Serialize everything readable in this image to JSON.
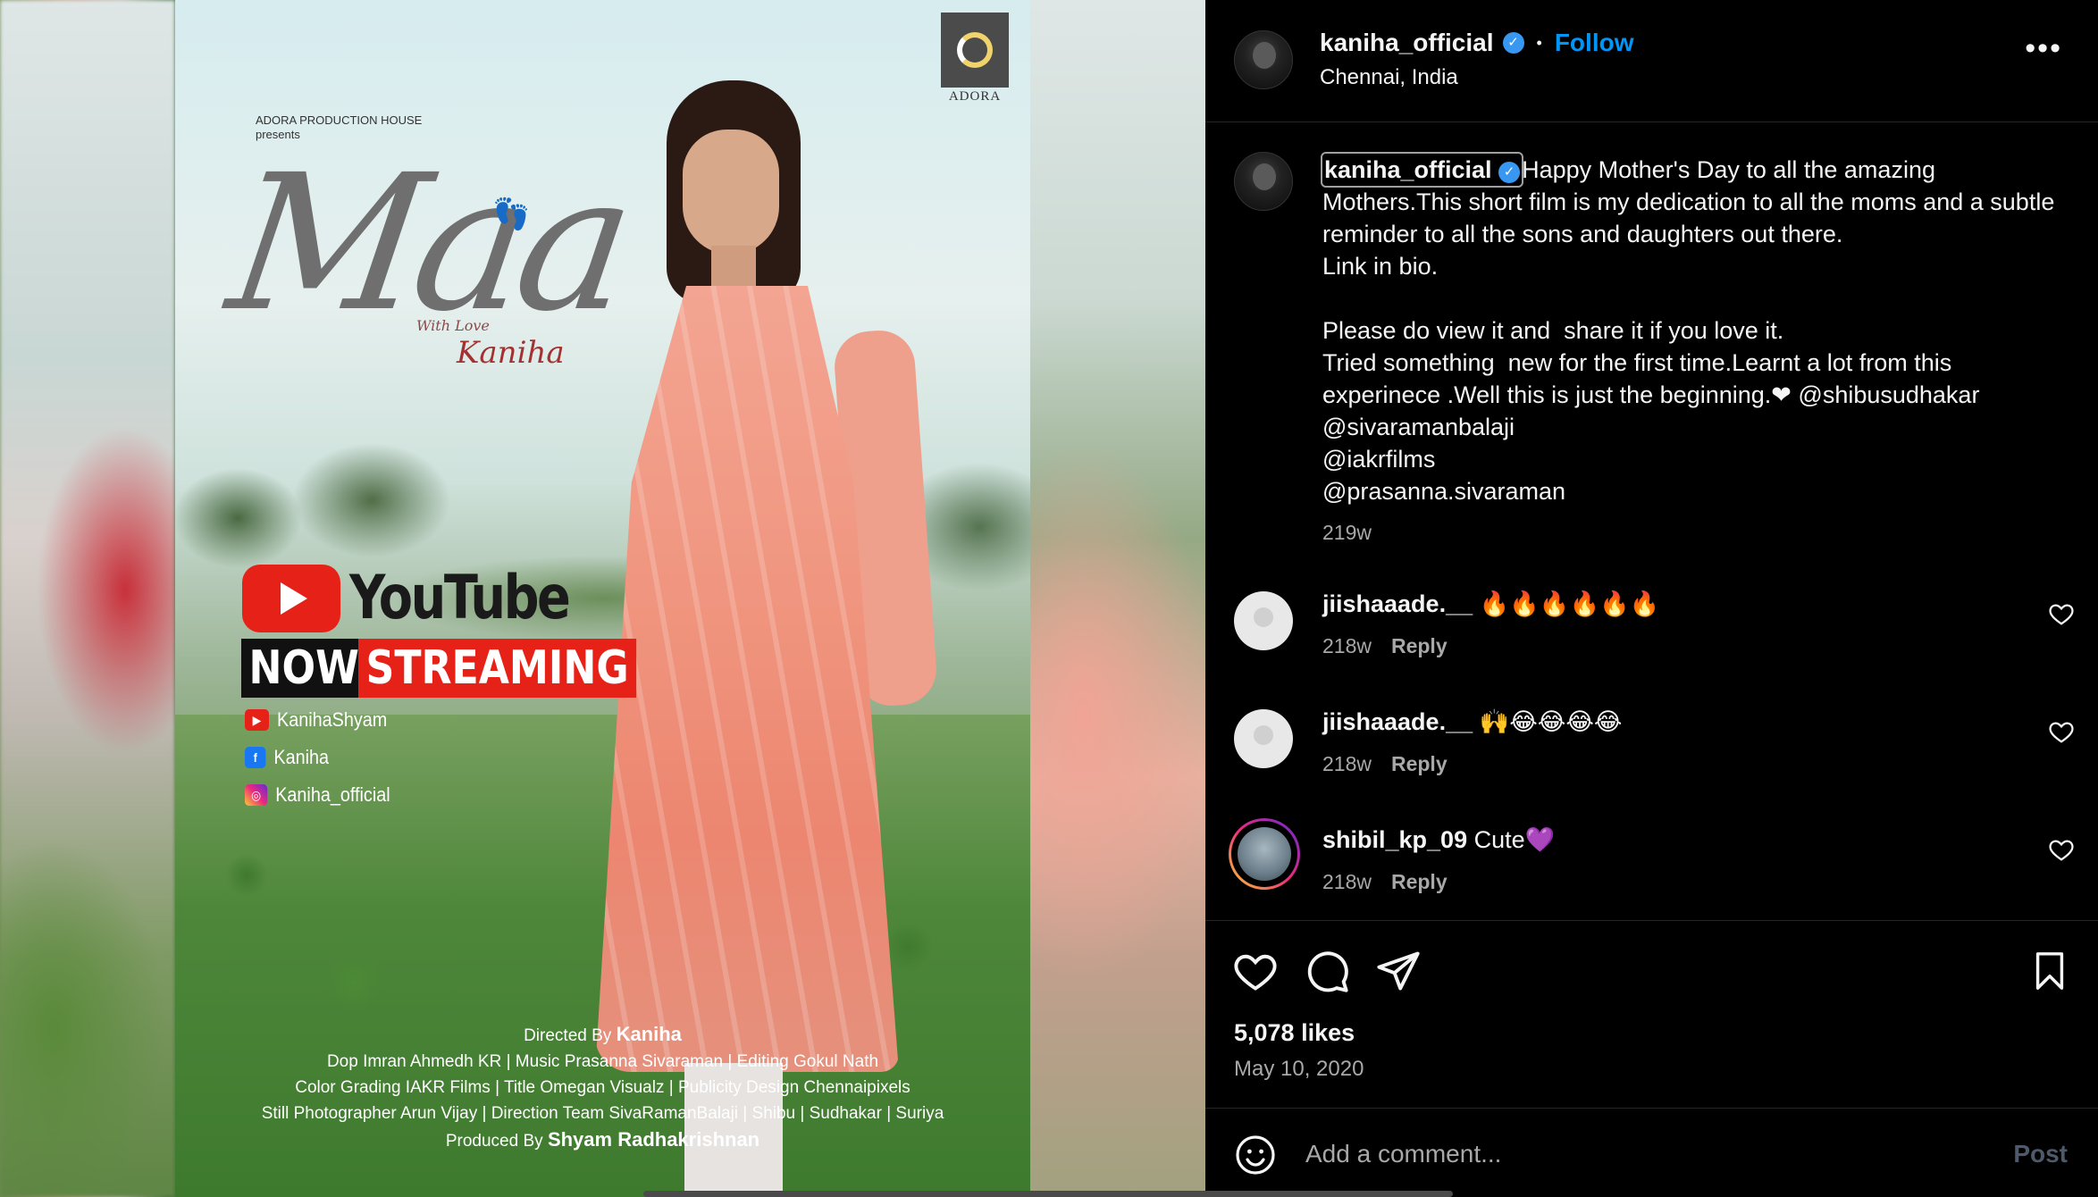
{
  "poster": {
    "logo_text": "ADORA",
    "presents_line1": "ADORA PRODUCTION HOUSE",
    "presents_line2": "presents",
    "title": "Maa",
    "with_love": "With Love",
    "signature": "Kaniha",
    "youtube_word": "YouTube",
    "now_word": "NOW",
    "streaming_word": "STREAMING",
    "social": [
      {
        "icon": "youtube-icon",
        "label": "KanihaShyam",
        "color": "#e62117"
      },
      {
        "icon": "facebook-icon",
        "label": "Kaniha",
        "color": "#1877f2"
      },
      {
        "icon": "instagram-icon",
        "label": "Kaniha_official",
        "color": "#d6249f"
      }
    ],
    "credits": {
      "directed_by_label": "Directed By",
      "directed_by": "Kaniha",
      "line2": "Dop Imran Ahmedh KR | Music Prasanna Sivaraman | Editing Gokul Nath",
      "line3": "Color Grading IAKR Films | Title Omegan Visualz | Publicity Design Chennaipixels",
      "line4": "Still Photographer Arun Vijay | Direction Team SivaRamanBalaji | Shibu | Sudhakar | Suriya",
      "produced_by_label": "Produced By",
      "produced_by": "Shyam Radhakrishnan"
    }
  },
  "header": {
    "username": "kaniha_official",
    "separator": "•",
    "follow_label": "Follow",
    "location": "Chennai, India",
    "more_icon": "more-horizontal-icon"
  },
  "caption": {
    "username": "kaniha_official",
    "text": "Happy Mother's Day to all the amazing Mothers.This short film is my dedication to all the moms and a subtle reminder to all the sons and daughters out there.\nLink in bio.\n\nPlease do view it and  share it if you love it.\nTried something  new for the first time.Learnt a lot from this experinece .Well this is just the beginning.❤ @shibusudhakar\n@sivaramanbalaji\n@iakrfilms\n@prasanna.sivaraman",
    "time": "219w"
  },
  "comments": [
    {
      "username": "jiishaaade.__",
      "text": "🔥🔥🔥🔥🔥🔥",
      "time": "218w",
      "reply_label": "Reply"
    },
    {
      "username": "jiishaaade.__",
      "text": "🙌😂😂😂😂",
      "time": "218w",
      "reply_label": "Reply"
    },
    {
      "username": "shibil_kp_09",
      "text": "Cute💜",
      "time": "218w",
      "reply_label": "Reply"
    }
  ],
  "actions": {
    "likes": "5,078 likes",
    "date": "May 10, 2020"
  },
  "add_comment": {
    "placeholder": "Add a comment...",
    "post_label": "Post"
  }
}
